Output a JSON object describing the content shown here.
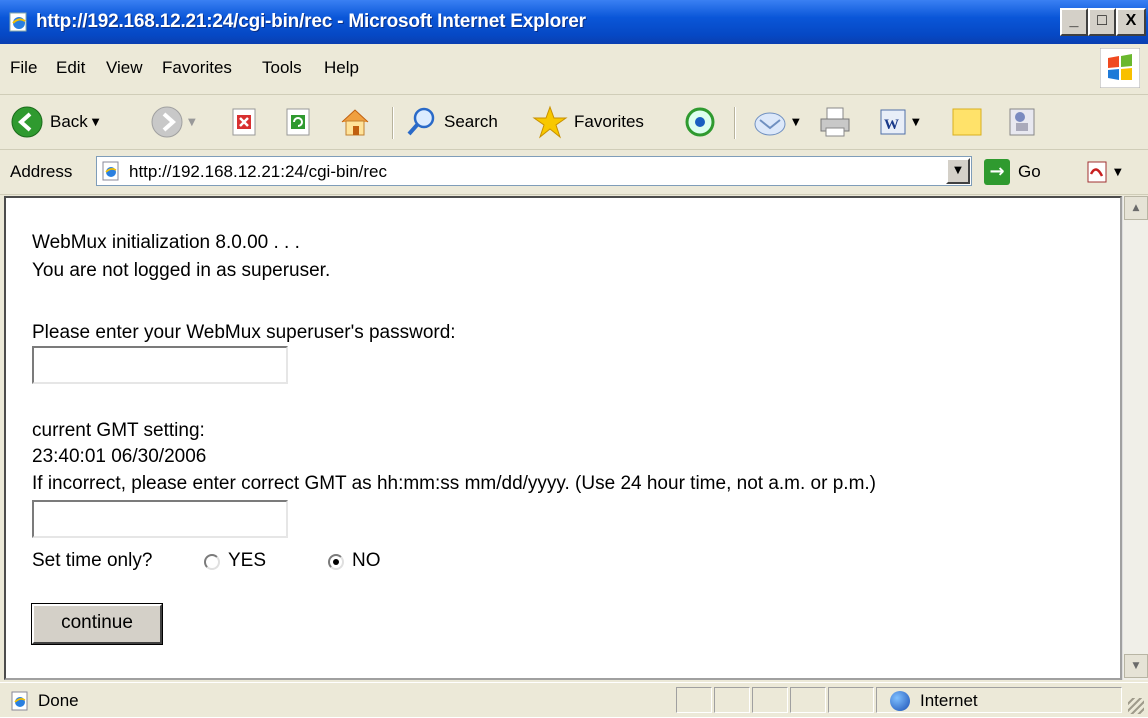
{
  "window": {
    "title": "http://192.168.12.21:24/cgi-bin/rec - Microsoft Internet Explorer",
    "controls": [
      "_",
      "□",
      "X"
    ]
  },
  "menu": [
    "File",
    "Edit",
    "View",
    "Favorites",
    "Tools",
    "Help"
  ],
  "toolbar": {
    "back_label": "Back",
    "search_label": "Search",
    "favorites_label": "Favorites"
  },
  "address": {
    "label": "Address",
    "url": "http://192.168.12.21:24/cgi-bin/rec",
    "go_label": "Go"
  },
  "page": {
    "line1": "WebMux initialization 8.0.00 . . .",
    "line2": "You are not logged in as superuser.",
    "password_prompt": "Please enter your WebMux superuser's password:",
    "password_value": "",
    "gmt_heading": "current GMT setting:",
    "gmt_value": "23:40:01 06/30/2006",
    "gmt_instructions": "If incorrect, please enter correct GMT as hh:mm:ss mm/dd/yyyy. (Use 24 hour time, not a.m. or p.m.)",
    "gmt_input_value": "",
    "set_time_label": "Set time only?",
    "radio_yes": "YES",
    "radio_no": "NO",
    "selected_option": "NO",
    "continue_label": "continue"
  },
  "status": {
    "text": "Done",
    "zone": "Internet"
  },
  "colors": {
    "titlebar": "#0a56d8",
    "chrome": "#ece9d8",
    "go_green": "#2f9a2f"
  }
}
